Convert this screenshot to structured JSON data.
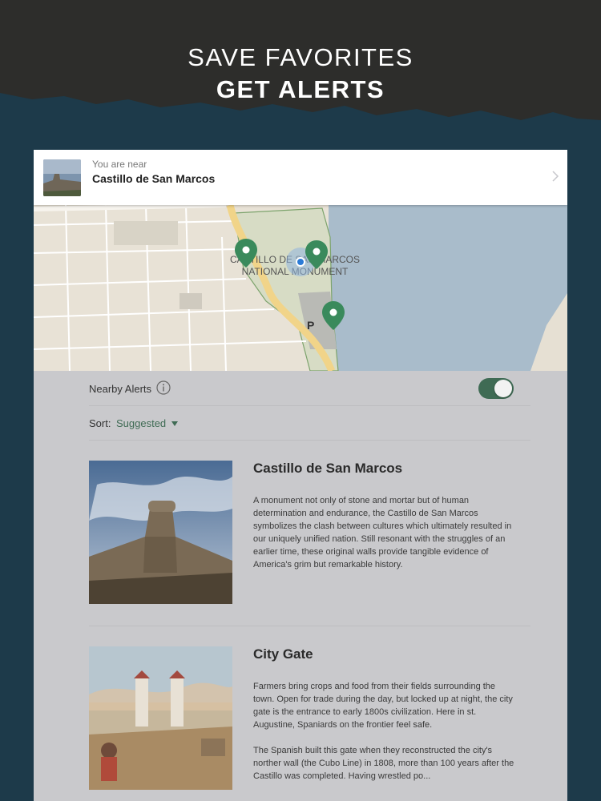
{
  "promo": {
    "line1": "SAVE FAVORITES",
    "line2": "GET ALERTS"
  },
  "nearby": {
    "label": "You are near",
    "place": "Castillo de San Marcos",
    "chevron_icon": "chevron-right-icon"
  },
  "map": {
    "area_label_line1": "CASTILLO DE SAN MARCOS",
    "area_label_line2": "NATIONAL MONUMENT",
    "parking_label": "P",
    "pin_color": "#3a8a5c",
    "user_dot_color": "#2b7bd6"
  },
  "alerts": {
    "label": "Nearby Alerts",
    "info_icon": "info-icon",
    "enabled": true
  },
  "sort": {
    "label": "Sort:",
    "value": "Suggested"
  },
  "places": [
    {
      "title": "Castillo de San Marcos",
      "description": "A monument not only of stone and mortar but of human determination and endurance, the Castillo de San Marcos symbolizes the clash between cultures which ultimately resulted in our uniquely unified nation.  Still resonant with the struggles of an earlier time, these original walls provide tangible evidence of America's grim but remarkable history."
    },
    {
      "title": "City Gate",
      "description": "Farmers bring crops and food from their fields surrounding the town. Open for trade during the day, but locked up at night, the city gate is the entrance to early 1800s civilization. Here in st. Augustine, Spaniards on the frontier feel safe.\n\nThe Spanish built this gate when they  reconstructed the city's norther wall (the Cubo Line) in 1808, more than 100 years after the Castillo was completed. Having wrestled po..."
    }
  ],
  "colors": {
    "accent": "#3f6b54",
    "background_dark": "#2d2d2b",
    "background_blue": "#1d3a4a",
    "panel": "#c9c9cc"
  }
}
